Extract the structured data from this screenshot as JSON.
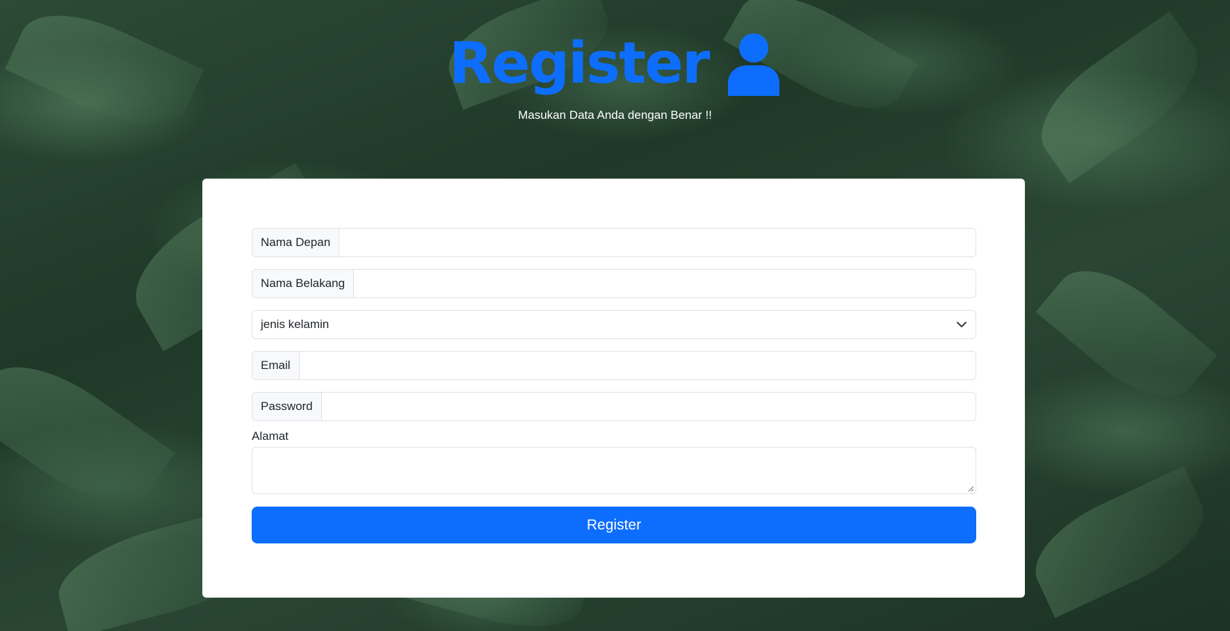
{
  "header": {
    "title": "Register",
    "subtitle": "Masukan Data Anda dengan Benar !!",
    "icon": "user-icon",
    "accent_color": "#0d6efd"
  },
  "form": {
    "first_name": {
      "label": "Nama Depan",
      "value": ""
    },
    "last_name": {
      "label": "Nama Belakang",
      "value": ""
    },
    "gender_select": {
      "selected": "jenis kelamin",
      "icon": "chevron-down-icon"
    },
    "email": {
      "label": "Email",
      "value": ""
    },
    "password": {
      "label": "Password",
      "value": ""
    },
    "address": {
      "label": "Alamat",
      "value": ""
    },
    "submit_label": "Register"
  }
}
